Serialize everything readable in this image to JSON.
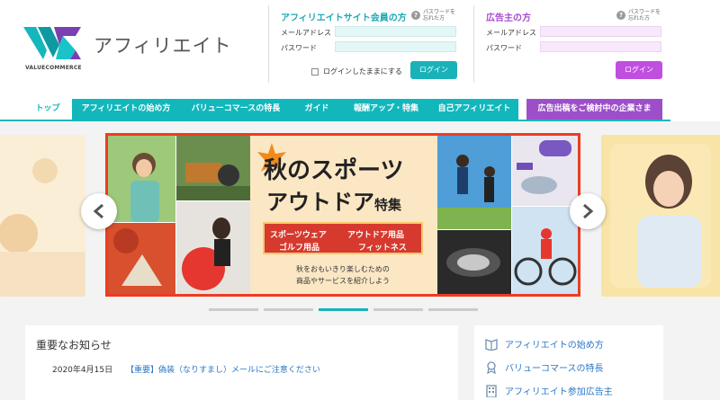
{
  "brand": {
    "logo_text": "VALUECOMMERCE",
    "name": "アフィリエイト"
  },
  "affiliate_login": {
    "title": "アフィリエイトサイト会員の方",
    "help_text": "パスワードを忘れた方",
    "email_label": "メールアドレス",
    "password_label": "パスワード",
    "keep_login": "ログインしたままにする",
    "login_button": "ログイン"
  },
  "advertiser_login": {
    "title": "広告主の方",
    "help_text": "パスワードを忘れた方",
    "email_label": "メールアドレス",
    "password_label": "パスワード",
    "login_button": "ログイン"
  },
  "nav": {
    "items": [
      "トップ",
      "アフィリエイトの始め方",
      "バリューコマースの特長",
      "ガイド",
      "報酬アップ・特集",
      "自己アフィリエイト"
    ],
    "advertiser": "広告出稿をご検討中の企業さま"
  },
  "banner": {
    "title_line1": "秋のスポーツ",
    "title_line2": "アウトドア",
    "title_suffix": "特集",
    "categories": [
      "スポーツウェア",
      "アウトドア用品",
      "ゴルフ用品",
      "フィットネス"
    ],
    "desc_line1": "秋をおもいきり楽しむための",
    "desc_line2": "商品やサービスを紹介しよう"
  },
  "notices": {
    "title": "重要なお知らせ",
    "items": [
      {
        "date": "2020年4月15日",
        "text": "【重要】偽装（なりすまし）メールにご注意ください"
      }
    ]
  },
  "side_links": [
    "アフィリエイトの始め方",
    "バリューコマースの特長",
    "アフィリエイト参加広告主"
  ],
  "colors": {
    "teal": "#12b7bc",
    "purple": "#9d4fc9",
    "banner_red": "#ed3c23",
    "link": "#2b77c8"
  }
}
